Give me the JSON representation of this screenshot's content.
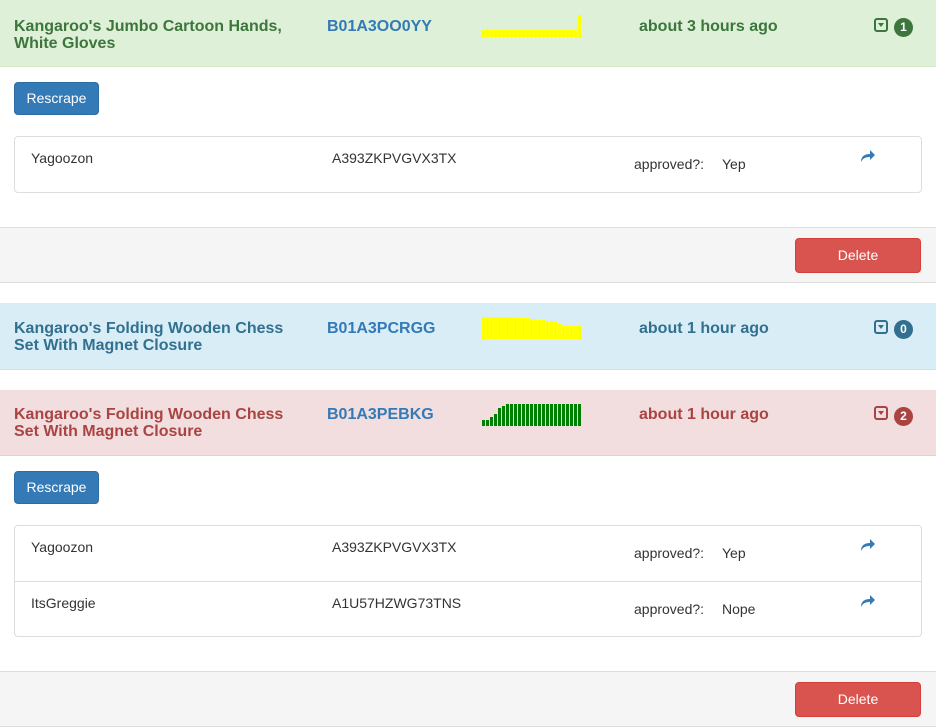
{
  "colors": {
    "success": "#3c763d",
    "info": "#31708f",
    "danger": "#a94442",
    "spark_yellow": "#ffff00",
    "spark_green": "#008000",
    "primary": "#337ab7",
    "delete": "#d9534f"
  },
  "buttons": {
    "rescrape": "Rescrape",
    "delete": "Delete"
  },
  "labels": {
    "approved": "approved?:"
  },
  "products": [
    {
      "title": "Kangaroo's Jumbo Cartoon Hands, White Gloves",
      "asin": "B01A3OO0YY",
      "time": "about 3 hours ago",
      "count": "1",
      "status": "success",
      "spark_color": "#ffff00",
      "spark": [
        0.3,
        0.3,
        0.3,
        0.3,
        0.3,
        0.3,
        0.3,
        0.3,
        0.3,
        0.3,
        0.3,
        0.3,
        0.3,
        0.3,
        0.3,
        0.3,
        0.3,
        0.3,
        0.3,
        0.3,
        0.3,
        0.3,
        0.3,
        0.3,
        1.0
      ],
      "reviews": [
        {
          "name": "Yagoozon",
          "id": "A393ZKPVGVX3TX",
          "approved": "Yep"
        }
      ]
    },
    {
      "title": "Kangaroo's Folding Wooden Chess Set With Magnet Closure",
      "asin": "B01A3PCRGG",
      "time": "about 1 hour ago",
      "count": "0",
      "status": "info",
      "spark_color": "#ffff00",
      "spark": [
        1.0,
        1.0,
        1.0,
        1.0,
        1.0,
        1.0,
        1.0,
        1.0,
        1.0,
        0.95,
        0.95,
        0.95,
        0.9,
        0.9,
        0.85,
        0.85,
        0.8,
        0.8,
        0.75,
        0.7,
        0.65,
        0.6,
        0.6,
        0.6,
        0.6
      ],
      "reviews": []
    },
    {
      "title": "Kangaroo's Folding Wooden Chess Set With Magnet Closure",
      "asin": "B01A3PEBKG",
      "time": "about 1 hour ago",
      "count": "2",
      "status": "danger",
      "spark_color": "#008000",
      "spark": [
        0.25,
        0.25,
        0.4,
        0.55,
        0.8,
        0.9,
        1.0,
        1.0,
        1.0,
        1.0,
        1.0,
        1.0,
        1.0,
        1.0,
        1.0,
        1.0,
        1.0,
        1.0,
        1.0,
        1.0,
        1.0,
        1.0,
        1.0,
        1.0,
        1.0
      ],
      "reviews": [
        {
          "name": "Yagoozon",
          "id": "A393ZKPVGVX3TX",
          "approved": "Yep"
        },
        {
          "name": "ItsGreggie",
          "id": "A1U57HZWG73TNS",
          "approved": "Nope"
        }
      ]
    }
  ]
}
